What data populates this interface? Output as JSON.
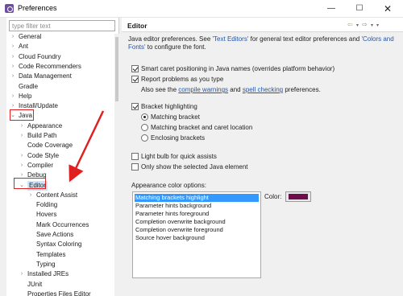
{
  "window": {
    "title": "Preferences",
    "controls": [
      "—",
      "☐",
      "✕"
    ]
  },
  "filter": {
    "placeholder": "type filter text"
  },
  "tree": [
    {
      "label": "General",
      "arrow": "›",
      "level": 0
    },
    {
      "label": "Ant",
      "arrow": "›",
      "level": 0
    },
    {
      "label": "Cloud Foundry",
      "arrow": "›",
      "level": 0
    },
    {
      "label": "Code Recommenders",
      "arrow": "›",
      "level": 0
    },
    {
      "label": "Data Management",
      "arrow": "›",
      "level": 0
    },
    {
      "label": "Gradle",
      "arrow": "",
      "level": 0
    },
    {
      "label": "Help",
      "arrow": "›",
      "level": 0
    },
    {
      "label": "Install/Update",
      "arrow": "›",
      "level": 0
    },
    {
      "label": "Java",
      "arrow": "⌄",
      "level": 0,
      "highlight": true
    },
    {
      "label": "Appearance",
      "arrow": "›",
      "level": 1
    },
    {
      "label": "Build Path",
      "arrow": "›",
      "level": 1
    },
    {
      "label": "Code Coverage",
      "arrow": "",
      "level": 1
    },
    {
      "label": "Code Style",
      "arrow": "›",
      "level": 1
    },
    {
      "label": "Compiler",
      "arrow": "›",
      "level": 1
    },
    {
      "label": "Debug",
      "arrow": "›",
      "level": 1
    },
    {
      "label": "Editor",
      "arrow": "⌄",
      "level": 1,
      "highlight": true,
      "selected": true
    },
    {
      "label": "Content Assist",
      "arrow": "›",
      "level": 2
    },
    {
      "label": "Folding",
      "arrow": "",
      "level": 2
    },
    {
      "label": "Hovers",
      "arrow": "",
      "level": 2
    },
    {
      "label": "Mark Occurrences",
      "arrow": "",
      "level": 2
    },
    {
      "label": "Save Actions",
      "arrow": "",
      "level": 2
    },
    {
      "label": "Syntax Coloring",
      "arrow": "",
      "level": 2
    },
    {
      "label": "Templates",
      "arrow": "",
      "level": 2
    },
    {
      "label": "Typing",
      "arrow": "",
      "level": 2
    },
    {
      "label": "Installed JREs",
      "arrow": "›",
      "level": 1
    },
    {
      "label": "JUnit",
      "arrow": "",
      "level": 1
    },
    {
      "label": "Properties Files Editor",
      "arrow": "",
      "level": 1
    }
  ],
  "page": {
    "title": "Editor",
    "nav": {
      "back": "⇦",
      "forward": "⇨",
      "dropdown": "▾"
    },
    "desc_1": "Java editor preferences. See ",
    "desc_link1": "'Text Editors'",
    "desc_2": " for general text editor preferences and ",
    "desc_link2": "'Colors and Fonts'",
    "desc_3": " to configure the font.",
    "options": [
      {
        "label": "Smart caret positioning in Java names (overrides platform behavior)",
        "type": "checkbox",
        "checked": true
      },
      {
        "label": "Report problems as you type",
        "type": "checkbox",
        "checked": true
      },
      {
        "label": "Bracket highlighting",
        "type": "checkbox",
        "checked": true
      },
      {
        "label": "Matching bracket",
        "type": "radio",
        "checked": true
      },
      {
        "label": "Matching bracket and caret location",
        "type": "radio",
        "checked": false
      },
      {
        "label": "Enclosing brackets",
        "type": "radio",
        "checked": false
      },
      {
        "label": "Light bulb for quick assists",
        "type": "checkbox",
        "checked": false
      },
      {
        "label": "Only show the selected Java element",
        "type": "checkbox",
        "checked": false
      }
    ],
    "also_see_1": "Also see the ",
    "also_see_link1": "compile warnings",
    "also_see_2": " and ",
    "also_see_link2": "spell checking",
    "also_see_3": " preferences.",
    "appearance_label": "Appearance color options:",
    "color_options": [
      "Matching brackets highlight",
      "Parameter hints background",
      "Parameter hints foreground",
      "Completion overwrite background",
      "Completion overwrite foreground",
      "Source hover background"
    ],
    "color_label": "Color:",
    "color_value": "#6e0c4c"
  },
  "colors": {
    "accent": "#3399ff",
    "annotation": "#e02020",
    "link": "#2457a6"
  }
}
